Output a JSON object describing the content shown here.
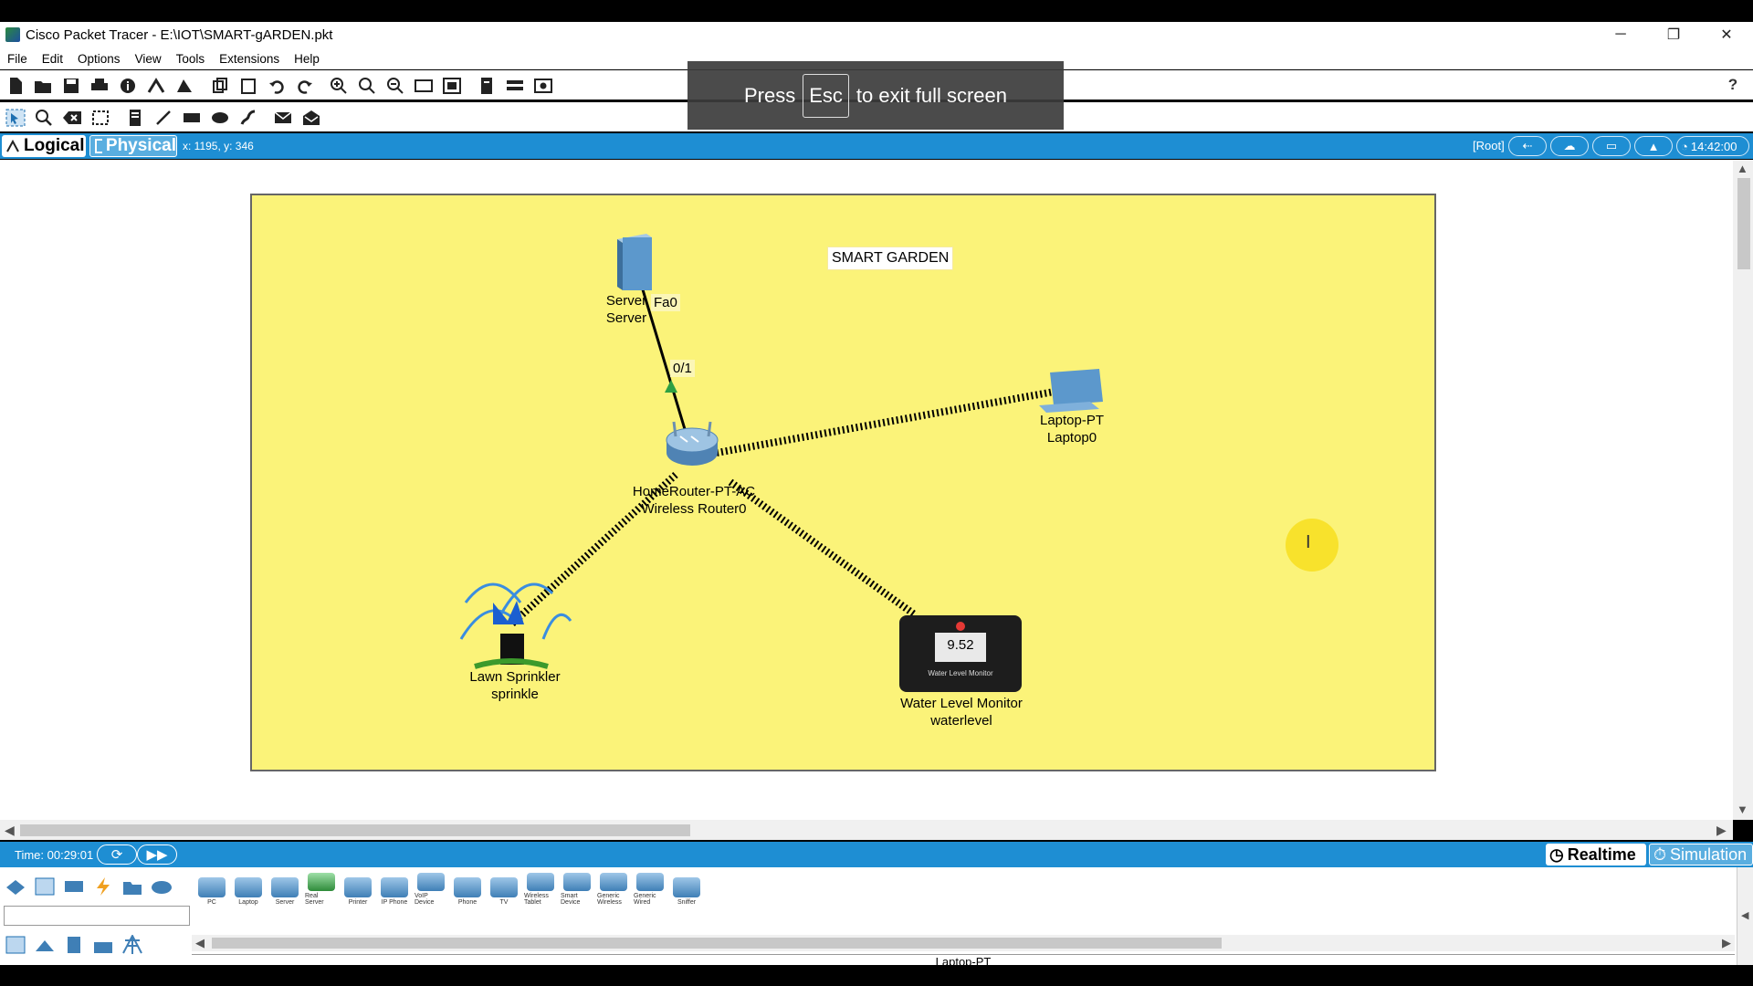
{
  "window": {
    "title": "Cisco Packet Tracer - E:\\IOT\\SMART-gARDEN.pkt",
    "minimize": "─",
    "restore": "❐",
    "close": "✕"
  },
  "menu": [
    "File",
    "Edit",
    "Options",
    "View",
    "Tools",
    "Extensions",
    "Help"
  ],
  "toolbar": {
    "help": "?"
  },
  "fullscreen_notice": {
    "before": "Press",
    "key": "Esc",
    "after": "to exit full screen"
  },
  "view_tabs": {
    "logical": "Logical",
    "physical": "Physical"
  },
  "coords_readout": "x: 1195, y: 346",
  "root_label": "[Root]",
  "clock": "14:42:00",
  "canvas": {
    "note": "SMART GARDEN",
    "devices": [
      {
        "id": "server",
        "type": "Server",
        "name": "Server"
      },
      {
        "id": "router",
        "type": "HomeRouter-PT-AC",
        "name": "Wireless Router0"
      },
      {
        "id": "laptop",
        "type": "Laptop-PT",
        "name": "Laptop0"
      },
      {
        "id": "sprinkler",
        "type": "Lawn Sprinkler",
        "name": "sprinkle"
      },
      {
        "id": "water",
        "type": "Water Level Monitor",
        "name": "waterlevel",
        "reading": "9.52",
        "caption": "Water Level Monitor"
      }
    ],
    "ports": {
      "server_port": "Fa0",
      "router_port": "0/1"
    }
  },
  "timebar": {
    "time": "Time: 00:29:01",
    "realtime": "Realtime",
    "simulation": "Simulation"
  },
  "palette": {
    "devices": [
      "PC",
      "Laptop",
      "Server",
      "Real Server",
      "Printer",
      "IP Phone",
      "VoIP Device",
      "Phone",
      "TV",
      "Wireless Tablet",
      "Smart Device",
      "Generic Wireless",
      "Generic Wired",
      "Sniffer"
    ],
    "status": "Laptop-PT"
  }
}
